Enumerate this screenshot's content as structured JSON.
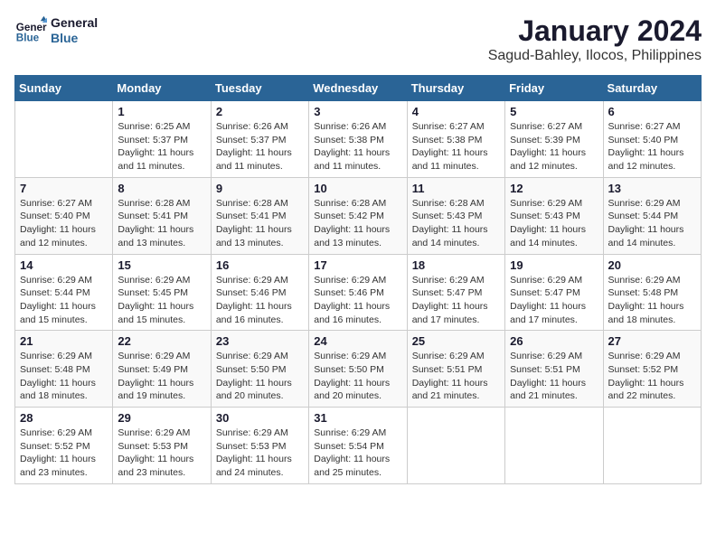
{
  "logo": {
    "line1": "General",
    "line2": "Blue"
  },
  "title": "January 2024",
  "subtitle": "Sagud-Bahley, Ilocos, Philippines",
  "days_of_week": [
    "Sunday",
    "Monday",
    "Tuesday",
    "Wednesday",
    "Thursday",
    "Friday",
    "Saturday"
  ],
  "weeks": [
    [
      {
        "day": "",
        "info": ""
      },
      {
        "day": "1",
        "info": "Sunrise: 6:25 AM\nSunset: 5:37 PM\nDaylight: 11 hours\nand 11 minutes."
      },
      {
        "day": "2",
        "info": "Sunrise: 6:26 AM\nSunset: 5:37 PM\nDaylight: 11 hours\nand 11 minutes."
      },
      {
        "day": "3",
        "info": "Sunrise: 6:26 AM\nSunset: 5:38 PM\nDaylight: 11 hours\nand 11 minutes."
      },
      {
        "day": "4",
        "info": "Sunrise: 6:27 AM\nSunset: 5:38 PM\nDaylight: 11 hours\nand 11 minutes."
      },
      {
        "day": "5",
        "info": "Sunrise: 6:27 AM\nSunset: 5:39 PM\nDaylight: 11 hours\nand 12 minutes."
      },
      {
        "day": "6",
        "info": "Sunrise: 6:27 AM\nSunset: 5:40 PM\nDaylight: 11 hours\nand 12 minutes."
      }
    ],
    [
      {
        "day": "7",
        "info": "Sunrise: 6:27 AM\nSunset: 5:40 PM\nDaylight: 11 hours\nand 12 minutes."
      },
      {
        "day": "8",
        "info": "Sunrise: 6:28 AM\nSunset: 5:41 PM\nDaylight: 11 hours\nand 13 minutes."
      },
      {
        "day": "9",
        "info": "Sunrise: 6:28 AM\nSunset: 5:41 PM\nDaylight: 11 hours\nand 13 minutes."
      },
      {
        "day": "10",
        "info": "Sunrise: 6:28 AM\nSunset: 5:42 PM\nDaylight: 11 hours\nand 13 minutes."
      },
      {
        "day": "11",
        "info": "Sunrise: 6:28 AM\nSunset: 5:43 PM\nDaylight: 11 hours\nand 14 minutes."
      },
      {
        "day": "12",
        "info": "Sunrise: 6:29 AM\nSunset: 5:43 PM\nDaylight: 11 hours\nand 14 minutes."
      },
      {
        "day": "13",
        "info": "Sunrise: 6:29 AM\nSunset: 5:44 PM\nDaylight: 11 hours\nand 14 minutes."
      }
    ],
    [
      {
        "day": "14",
        "info": "Sunrise: 6:29 AM\nSunset: 5:44 PM\nDaylight: 11 hours\nand 15 minutes."
      },
      {
        "day": "15",
        "info": "Sunrise: 6:29 AM\nSunset: 5:45 PM\nDaylight: 11 hours\nand 15 minutes."
      },
      {
        "day": "16",
        "info": "Sunrise: 6:29 AM\nSunset: 5:46 PM\nDaylight: 11 hours\nand 16 minutes."
      },
      {
        "day": "17",
        "info": "Sunrise: 6:29 AM\nSunset: 5:46 PM\nDaylight: 11 hours\nand 16 minutes."
      },
      {
        "day": "18",
        "info": "Sunrise: 6:29 AM\nSunset: 5:47 PM\nDaylight: 11 hours\nand 17 minutes."
      },
      {
        "day": "19",
        "info": "Sunrise: 6:29 AM\nSunset: 5:47 PM\nDaylight: 11 hours\nand 17 minutes."
      },
      {
        "day": "20",
        "info": "Sunrise: 6:29 AM\nSunset: 5:48 PM\nDaylight: 11 hours\nand 18 minutes."
      }
    ],
    [
      {
        "day": "21",
        "info": "Sunrise: 6:29 AM\nSunset: 5:48 PM\nDaylight: 11 hours\nand 18 minutes."
      },
      {
        "day": "22",
        "info": "Sunrise: 6:29 AM\nSunset: 5:49 PM\nDaylight: 11 hours\nand 19 minutes."
      },
      {
        "day": "23",
        "info": "Sunrise: 6:29 AM\nSunset: 5:50 PM\nDaylight: 11 hours\nand 20 minutes."
      },
      {
        "day": "24",
        "info": "Sunrise: 6:29 AM\nSunset: 5:50 PM\nDaylight: 11 hours\nand 20 minutes."
      },
      {
        "day": "25",
        "info": "Sunrise: 6:29 AM\nSunset: 5:51 PM\nDaylight: 11 hours\nand 21 minutes."
      },
      {
        "day": "26",
        "info": "Sunrise: 6:29 AM\nSunset: 5:51 PM\nDaylight: 11 hours\nand 21 minutes."
      },
      {
        "day": "27",
        "info": "Sunrise: 6:29 AM\nSunset: 5:52 PM\nDaylight: 11 hours\nand 22 minutes."
      }
    ],
    [
      {
        "day": "28",
        "info": "Sunrise: 6:29 AM\nSunset: 5:52 PM\nDaylight: 11 hours\nand 23 minutes."
      },
      {
        "day": "29",
        "info": "Sunrise: 6:29 AM\nSunset: 5:53 PM\nDaylight: 11 hours\nand 23 minutes."
      },
      {
        "day": "30",
        "info": "Sunrise: 6:29 AM\nSunset: 5:53 PM\nDaylight: 11 hours\nand 24 minutes."
      },
      {
        "day": "31",
        "info": "Sunrise: 6:29 AM\nSunset: 5:54 PM\nDaylight: 11 hours\nand 25 minutes."
      },
      {
        "day": "",
        "info": ""
      },
      {
        "day": "",
        "info": ""
      },
      {
        "day": "",
        "info": ""
      }
    ]
  ]
}
